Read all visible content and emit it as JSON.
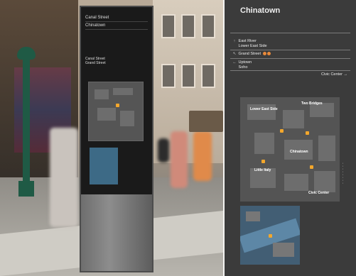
{
  "kiosk": {
    "header_lines": [
      "Canal Street",
      "Chinatown"
    ],
    "directions": [
      "Canal Street",
      "Grand Street"
    ],
    "footer_left": "",
    "footer_right": ""
  },
  "panel": {
    "title": "Chinatown",
    "rows": [
      {
        "icon": "arrow-up-icon",
        "glyph": "↑",
        "lines": [
          "East River",
          "Lower East Side"
        ]
      },
      {
        "icon": "arrow-up-left-icon",
        "glyph": "↖",
        "lines": [
          "Grand Street"
        ],
        "badges": 2
      },
      {
        "icon": "arrow-left-icon",
        "glyph": "←",
        "lines": [
          "Uptown",
          "Soho"
        ]
      }
    ],
    "civic_center": "Civic Center →",
    "map_labels": [
      {
        "text": "Lower East Side"
      },
      {
        "text": "Two Bridges"
      },
      {
        "text": "Chinatown"
      },
      {
        "text": "Little Italy"
      },
      {
        "text": "Civic Center"
      }
    ]
  },
  "colors": {
    "panel_bg": "#3b3b3b",
    "accent": "#f3a72c",
    "kiosk": "#1a1a1a"
  }
}
